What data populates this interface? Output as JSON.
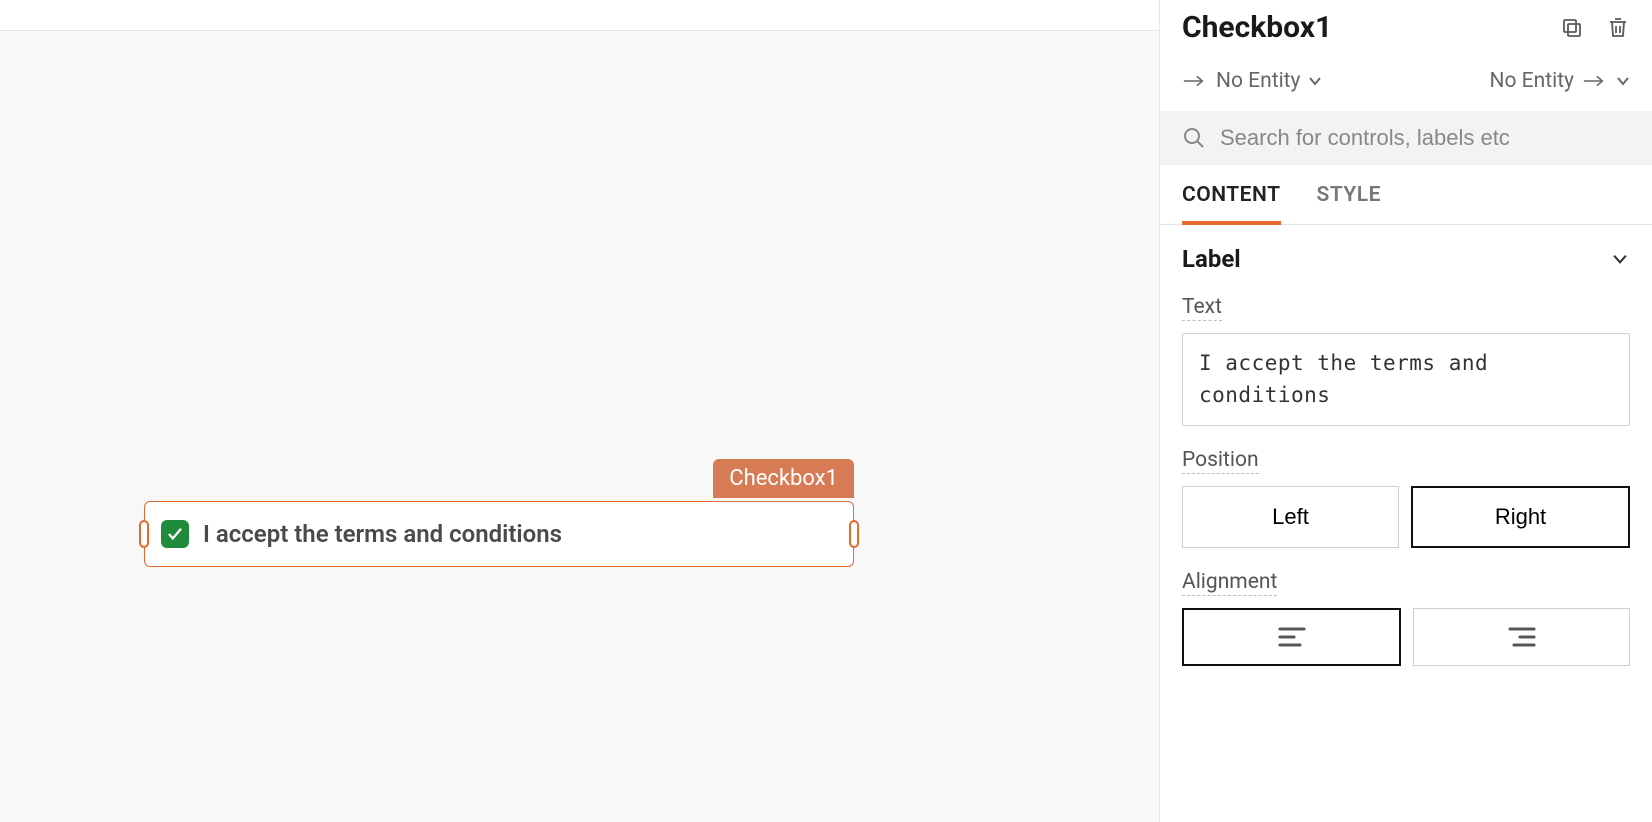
{
  "canvas": {
    "widget_name": "Checkbox1",
    "checkbox_label": "I accept the terms and conditions"
  },
  "panel": {
    "title": "Checkbox1",
    "entity_left": "No Entity",
    "entity_right": "No Entity",
    "search_placeholder": "Search for controls, labels etc",
    "tabs": {
      "content": "CONTENT",
      "style": "STYLE"
    },
    "section_label": "Label",
    "fields": {
      "text_label": "Text",
      "text_value": "I accept the terms and conditions",
      "position_label": "Position",
      "position_left": "Left",
      "position_right": "Right",
      "alignment_label": "Alignment"
    }
  }
}
